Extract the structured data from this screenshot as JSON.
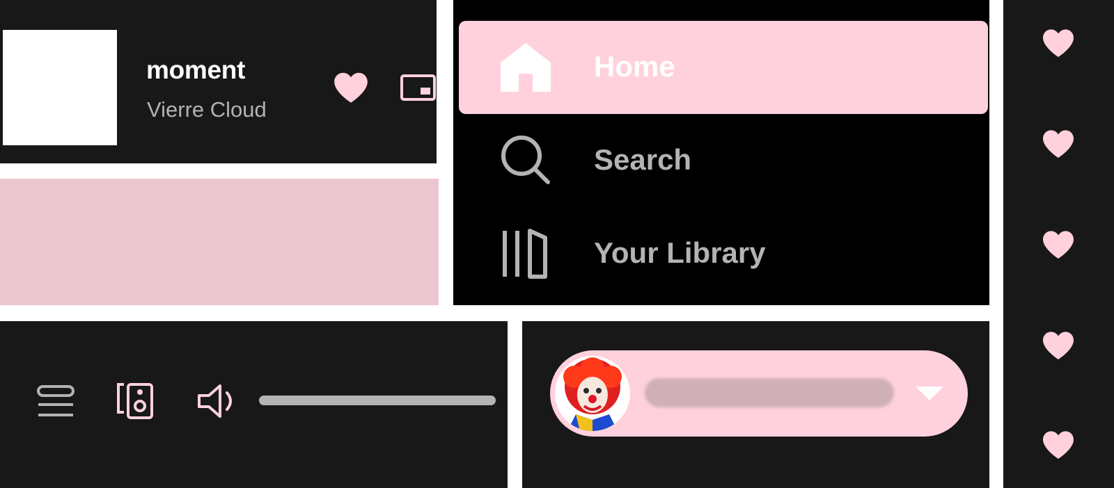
{
  "now_playing": {
    "title": "moment",
    "artist": "Vierre Cloud",
    "like_icon": "heart-icon",
    "pip_icon": "picture-in-picture-icon"
  },
  "nav": {
    "items": [
      {
        "label": "Home",
        "icon": "home-icon",
        "active": true
      },
      {
        "label": "Search",
        "icon": "search-icon",
        "active": false
      },
      {
        "label": "Your Library",
        "icon": "library-icon",
        "active": false
      }
    ]
  },
  "controls": {
    "queue_icon": "queue-icon",
    "devices_icon": "connect-device-icon",
    "volume_icon": "volume-icon",
    "volume_level": 1.0
  },
  "user": {
    "display_name": "",
    "avatar_icon": "clown-avatar",
    "dropdown_icon": "caret-down-icon"
  },
  "hearts_column": {
    "count": 5,
    "icon": "heart-icon"
  },
  "colors": {
    "accent_pink": "#ffd1dc",
    "panel_dark": "#181818",
    "nav_black": "#000000",
    "muted_text": "#b3b3b3",
    "pink_block": "#ebc6ce"
  }
}
